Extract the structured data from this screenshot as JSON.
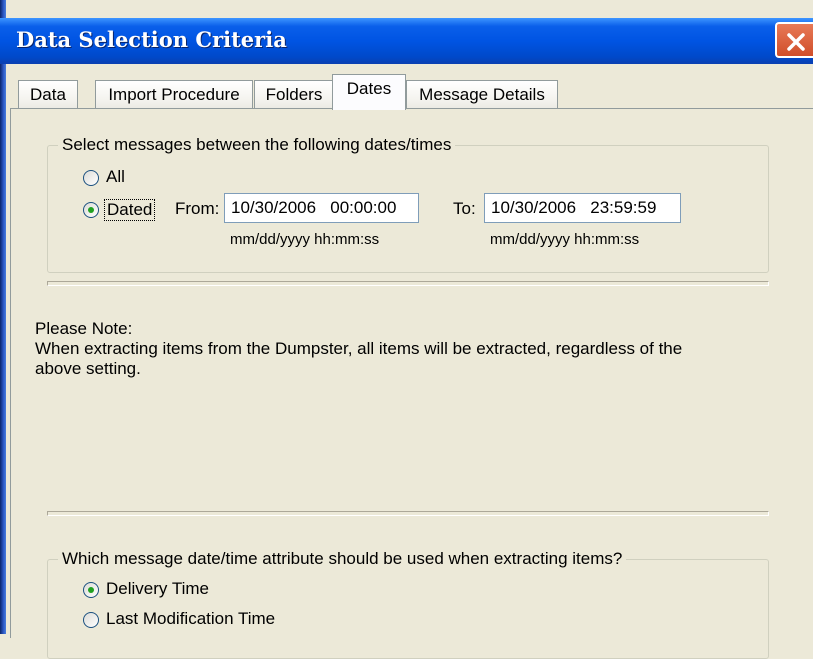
{
  "window": {
    "title": "Data Selection Criteria"
  },
  "tabs": [
    {
      "label": "Data"
    },
    {
      "label": "Import Procedure"
    },
    {
      "label": "Folders"
    },
    {
      "label": "Dates",
      "active": true
    },
    {
      "label": "Message Details"
    }
  ],
  "date_group": {
    "legend": "Select messages between the following dates/times",
    "option_all": "All",
    "option_dated": "Dated",
    "selected": "Dated",
    "from_label": "From:",
    "from_value": "10/30/2006   00:00:00",
    "to_label": "To:",
    "to_value": "10/30/2006   23:59:59",
    "format_hint_from": "mm/dd/yyyy   hh:mm:ss",
    "format_hint_to": "mm/dd/yyyy   hh:mm:ss"
  },
  "note": {
    "heading": "Please Note:",
    "line1": "When extracting items from the Dumpster, all items will be extracted, regardless of the",
    "line2": "above setting."
  },
  "attribute_group": {
    "legend": "Which message date/time attribute should be used when extracting items?",
    "option_delivery": "Delivery Time",
    "option_modification": "Last Modification Time",
    "selected": "Delivery Time"
  },
  "colors": {
    "titlebar": "#0054E3",
    "face": "#ECE9D8",
    "close_button": "#D04E2A",
    "radio_dot": "#21A121"
  }
}
